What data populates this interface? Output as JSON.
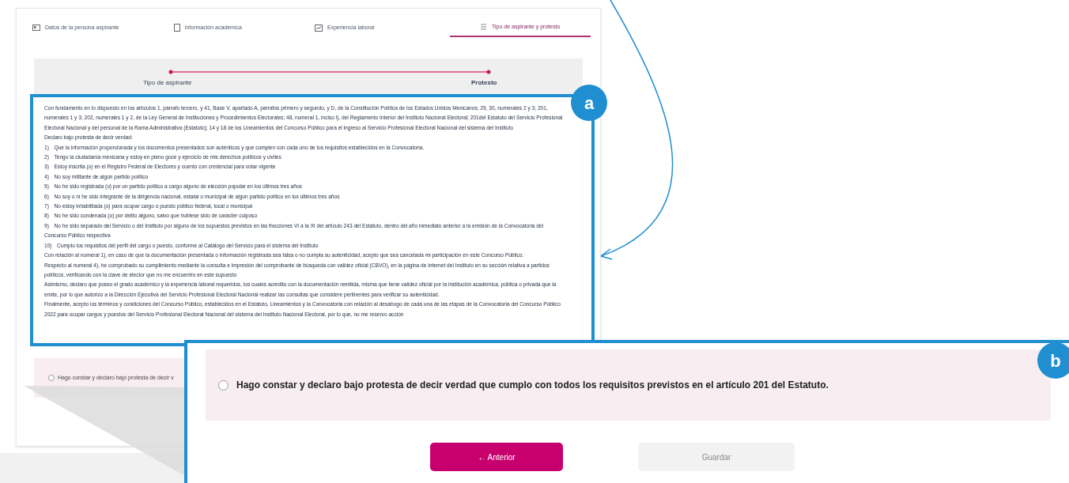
{
  "tabs": [
    {
      "label": "Datos de la persona aspirante",
      "selected": false
    },
    {
      "label": "Información académica",
      "selected": false
    },
    {
      "label": "Experiencia laboral",
      "selected": false
    },
    {
      "label": "Tipo de aspirante y protesto",
      "selected": true
    }
  ],
  "stepper": {
    "steps": [
      {
        "label": "Tipo de aspirante",
        "current": false
      },
      {
        "label": "Protesto",
        "current": true
      }
    ]
  },
  "declaration": {
    "intro": [
      "Con fundamento en lo dispuesto en los artículos 1, párrafo tercero, y 41, Base V, apartado A, párrafos primero y segundo, y D, de la Constitución Política de los Estados Unidos Mexicanos; 29, 30, numerales 2 y 3; 201, numerales 1 y 3; 202, numerales 1 y 2, de la Ley General de Instituciones y Procedimientos Electorales; 48, numeral 1, inciso l), del Reglamento Interior del Instituto Nacional Electoral; 201del Estatuto del Servicio Profesional Electoral Nacional y del personal de la Rama Administrativa (Estatuto); 14 y 18 de los Lineamientos del Concurso Público para el ingreso al Servicio Profesional Electoral Nacional del sistema del Instituto",
      "Declaro bajo protesta de decir verdad:"
    ],
    "items": [
      {
        "number": "1)",
        "text": "Que la información proporcionada y los documentos presentados son auténticos y que cumplen con cada uno de los requisitos establecidos en la Convocatoria."
      },
      {
        "number": "2)",
        "text": "Tengo la ciudadanía mexicana y estoy en pleno goce y ejercicio de mis derechos políticos y civiles"
      },
      {
        "number": "3)",
        "text": "Estoy inscrita (o) en el Registro Federal de Electores y cuento con credencial para votar vigente"
      },
      {
        "number": "4)",
        "text": "No soy militante de algún partido político"
      },
      {
        "number": "5)",
        "text": "No he sido registrada (o) por un partido político a cargo alguno de elección popular en los últimos tres años"
      },
      {
        "number": "6)",
        "text": "No soy o ni he sido integrante de la dirigencia nacional, estatal o municipal de algún partido político en los últimos tres años"
      },
      {
        "number": "7)",
        "text": "No estoy inhabilitada (o) para ocupar cargo o puesto público federal, local o municipal"
      },
      {
        "number": "8)",
        "text": "No he sido condenada (o) por delito alguno, salvo que hubiese sido de carácter culposo"
      },
      {
        "number": "9)",
        "text": "No he sido separado del Servicio o del Instituto por alguno de los supuestos previstos en las fracciones VI a la XI del artículo 243 del Estatuto, dentro del año inmediato anterior a la emisión de la Convocatoria del Concurso Público respectiva"
      },
      {
        "number": "10)",
        "text": "Cumplo los requisitos del perfil del cargo o puesto, conforme al Catálogo del Servicio para el sistema del Instituto"
      }
    ],
    "closing": [
      "Con relación al numeral 1), en caso de que la documentación presentada o información registrada sea falsa o no cumpla su autenticidad, acepto que sea cancelada mi participación en este Concurso Público.",
      "Respecto al numeral 4), he comprobado su cumplimiento mediante la consulta e impresión del comprobante de búsqueda con validez oficial (CBVO), en la página de internet del Instituto en su sección relativa a partidos políticos, verificando con la clave de elector que no me encuentro en este supuesto",
      "Asimismo, declaro que poseo el grado académico y la experiencia laboral requeridos, los cuales acredito con la documentación remitida, misma que tiene validez oficial por la institución académica, pública o privada que la emite, por lo que autorizo a la Dirección Ejecutiva del Servicio Profesional Electoral Nacional realizar las consultas que considere pertinentes para verificar su autenticidad.",
      "Finalmente, acepto los términos y condiciones del Concurso Público, establecidos en el Estatuto, Lineamientos y la Convocatoria con relación al desahogo de cada una de las etapas de la Convocatoria del Concurso Público 2022 para ocupar cargos y puestos del Servicio Profesional Electoral Nacional del sistema del Instituto Nacional Electoral, por lo que, no me reservo acción"
    ]
  },
  "statement": {
    "text": "Hago constar y declaro bajo protesta de decir v",
    "checked": false
  },
  "zoom": {
    "statement": {
      "text": "Hago constar y declaro bajo protesta de decir verdad que cumplo con todos los requisitos previstos en el artículo 201 del Estatuto.",
      "checked": false
    },
    "buttons": [
      {
        "label": "← Anterior",
        "disabled": false
      },
      {
        "label": "Guardar",
        "disabled": true
      }
    ]
  },
  "annotations": [
    {
      "label": "a"
    },
    {
      "label": "b"
    }
  ]
}
